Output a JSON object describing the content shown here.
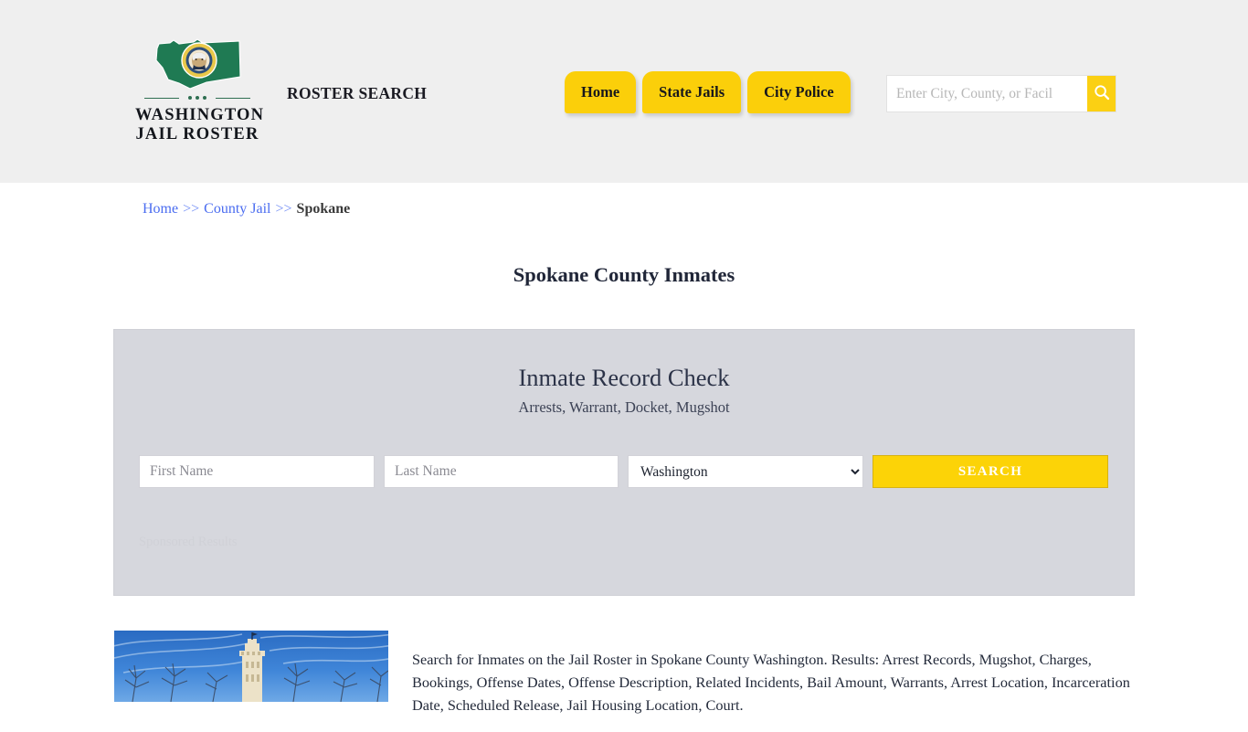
{
  "header": {
    "brand": {
      "line1": "WASHINGTON",
      "line2": "JAIL ROSTER",
      "flag_icon": "washington-state-flag-icon",
      "seal_icon": "state-seal-icon"
    },
    "tagline": "ROSTER SEARCH",
    "nav": [
      {
        "label": "Home"
      },
      {
        "label": "State Jails"
      },
      {
        "label": "City Police"
      }
    ],
    "search": {
      "placeholder": "Enter City, County, or Facil",
      "value": "",
      "button_icon": "search-icon"
    },
    "background_color": "#efefef",
    "accent_color": "#fbcf0a"
  },
  "breadcrumb": {
    "items": [
      {
        "label": "Home",
        "link": true
      },
      {
        "label": "County Jail",
        "link": true
      },
      {
        "label": "Spokane",
        "link": false
      }
    ],
    "separator": ">>"
  },
  "page": {
    "title": "Spokane County Inmates"
  },
  "ad_panel": {
    "title": "Inmate Record Check",
    "subtitle": "Arrests, Warrant, Docket, Mugshot",
    "first_name_placeholder": "First Name",
    "first_name_value": "",
    "last_name_placeholder": "Last Name",
    "last_name_value": "",
    "state_selected": "Washington",
    "state_options": [
      "Washington"
    ],
    "search_button": "SEARCH",
    "sponsored_label": "Sponsored Results",
    "background_color": "#d6d7dd",
    "button_color": "#fcd307"
  },
  "content": {
    "photo_alt": "spokane-county-courthouse-tower-photo",
    "paragraph": "Search for Inmates on the Jail Roster in Spokane County Washington. Results: Arrest Records, Mugshot, Charges, Bookings, Offense Dates, Offense Description, Related Incidents, Bail Amount, Warrants, Arrest Location, Incarceration Date, Scheduled Release, Jail Housing Location, Court."
  }
}
